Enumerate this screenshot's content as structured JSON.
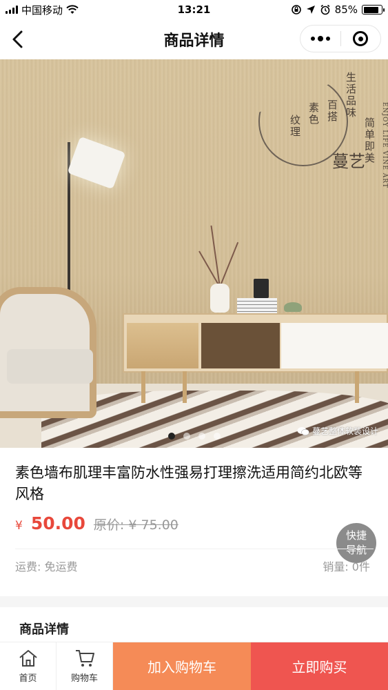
{
  "status_bar": {
    "carrier": "中国移动",
    "time": "13:21",
    "battery_percent": "85%",
    "battery_level": 0.85
  },
  "nav": {
    "title": "商品详情"
  },
  "product_image": {
    "brand_lines": [
      "生活品味",
      "简单即美",
      "百搭",
      "素色",
      "纹理"
    ],
    "brand_english": "ENJOY LIFE VINE ART",
    "brand_mark": "蔓艺",
    "watermark": "蔓艺整体软装设计",
    "slide_count": 4,
    "active_slide": 1
  },
  "product": {
    "title": "素色墙布肌理丰富防水性强易打理擦洗适用简约北欧等风格",
    "currency_symbol": "¥",
    "price": "50.00",
    "original_price": "原价: ¥ 75.00",
    "shipping": "运费: 免运费",
    "sales": "销量: 0件"
  },
  "quick_nav": {
    "line1": "快捷",
    "line2": "导航"
  },
  "detail": {
    "heading": "商品详情"
  },
  "bottom_bar": {
    "home_label": "首页",
    "cart_label": "购物车",
    "add_to_cart": "加入购物车",
    "buy_now": "立即购买"
  },
  "colors": {
    "price_red": "#e8483b",
    "add_cart_orange": "#f58b57",
    "buy_red": "#ef5550"
  }
}
